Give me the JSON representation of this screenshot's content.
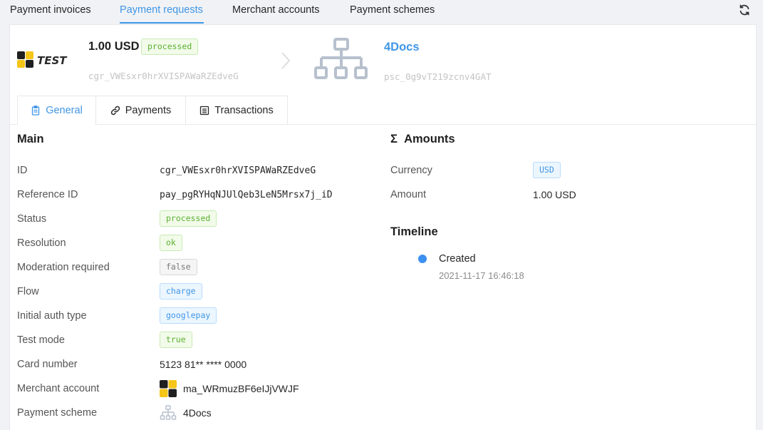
{
  "nav": {
    "tabs": [
      {
        "label": "Payment invoices",
        "active": false
      },
      {
        "label": "Payment requests",
        "active": true
      },
      {
        "label": "Merchant accounts",
        "active": false
      },
      {
        "label": "Payment schemes",
        "active": false
      }
    ],
    "refresh_icon": "refresh-icon"
  },
  "header": {
    "logo_text": "TEST",
    "amount": "1.00 USD",
    "status": "processed",
    "id": "cgr_VWEsxr0hrXVISPAWaRZEdveG",
    "scheme_name": "4Docs",
    "scheme_id": "psc_0g9vT219zcnv4GAT"
  },
  "tabs": [
    {
      "label": "General",
      "icon": "clipboard-icon",
      "active": true
    },
    {
      "label": "Payments",
      "icon": "link-icon",
      "active": false
    },
    {
      "label": "Transactions",
      "icon": "list-icon",
      "active": false
    }
  ],
  "main": {
    "title": "Main",
    "rows": {
      "id": {
        "label": "ID",
        "value": "cgr_VWEsxr0hrXVISPAWaRZEdveG"
      },
      "reference_id": {
        "label": "Reference ID",
        "value": "pay_pgRYHqNJUlQeb3LeN5Mrsx7j_iD"
      },
      "status": {
        "label": "Status",
        "value": "processed"
      },
      "resolution": {
        "label": "Resolution",
        "value": "ok"
      },
      "moderation": {
        "label": "Moderation required",
        "value": "false"
      },
      "flow": {
        "label": "Flow",
        "value": "charge"
      },
      "auth_type": {
        "label": "Initial auth type",
        "value": "googlepay"
      },
      "test_mode": {
        "label": "Test mode",
        "value": "true"
      },
      "card_number": {
        "label": "Card number",
        "value": "5123 81** **** 0000"
      },
      "merchant_account": {
        "label": "Merchant account",
        "value": "ma_WRmuzBF6eIJjVWJF"
      },
      "payment_scheme": {
        "label": "Payment scheme",
        "value": "4Docs"
      }
    }
  },
  "amounts": {
    "title_symbol": "Σ",
    "title": "Amounts",
    "currency_label": "Currency",
    "currency": "USD",
    "amount_label": "Amount",
    "amount": "1.00 USD"
  },
  "timeline": {
    "title": "Timeline",
    "events": [
      {
        "title": "Created",
        "time": "2021-11-17 16:46:18"
      }
    ]
  },
  "colors": {
    "accent": "#4096e6",
    "success": "#5bb030",
    "logo_yellow": "#f5c518",
    "logo_dark": "#1f1f1f"
  }
}
